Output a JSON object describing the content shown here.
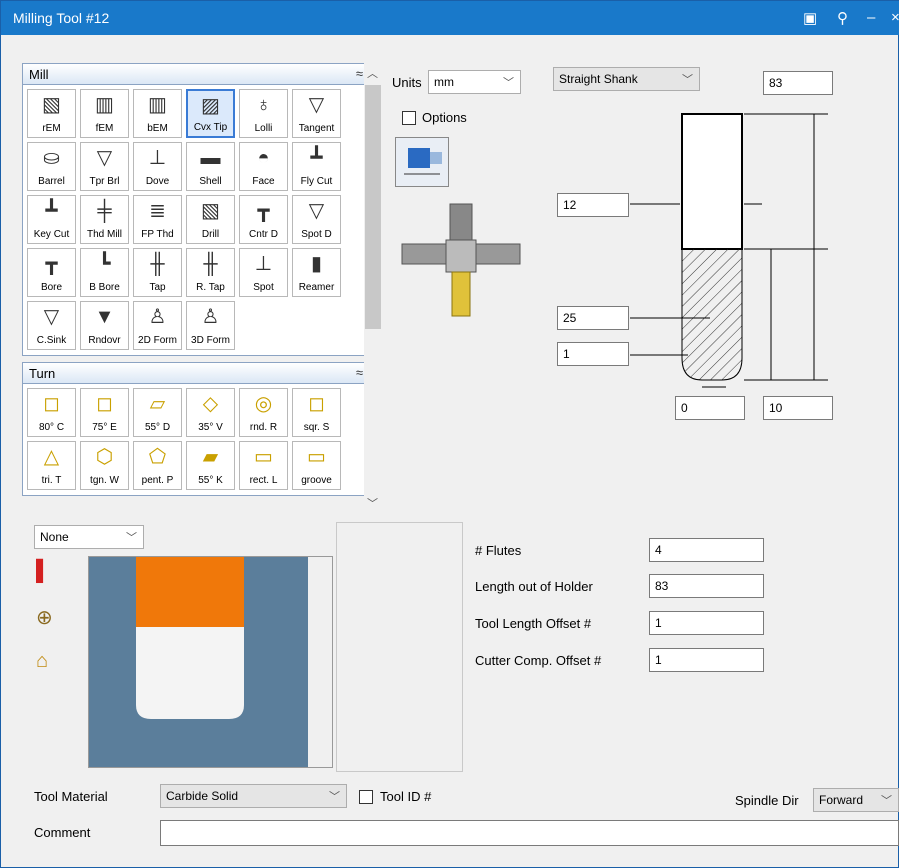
{
  "window": {
    "title": "Milling Tool #12"
  },
  "mill": {
    "header": "Mill",
    "tools": [
      {
        "label": "rEM",
        "icon": "rem-icon",
        "glyph": "▧"
      },
      {
        "label": "fEM",
        "icon": "fem-icon",
        "glyph": "▥"
      },
      {
        "label": "bEM",
        "icon": "bem-icon",
        "glyph": "▥"
      },
      {
        "label": "Cvx Tip",
        "icon": "convex-tip-icon",
        "glyph": "▨",
        "selected": true
      },
      {
        "label": "Lolli",
        "icon": "lollipop-icon",
        "glyph": "♁"
      },
      {
        "label": "Tangent",
        "icon": "tangent-icon",
        "glyph": "▽"
      },
      {
        "label": "Barrel",
        "icon": "barrel-icon",
        "glyph": "⛀"
      },
      {
        "label": "Tpr Brl",
        "icon": "taper-barrel-icon",
        "glyph": "▽"
      },
      {
        "label": "Dove",
        "icon": "dovetail-icon",
        "glyph": "⊥"
      },
      {
        "label": "Shell",
        "icon": "shell-mill-icon",
        "glyph": "▬"
      },
      {
        "label": "Face",
        "icon": "face-mill-icon",
        "glyph": "◓"
      },
      {
        "label": "Fly Cut",
        "icon": "fly-cutter-icon",
        "glyph": "┻"
      },
      {
        "label": "Key Cut",
        "icon": "key-cutter-icon",
        "glyph": "┻"
      },
      {
        "label": "Thd Mill",
        "icon": "thread-mill-icon",
        "glyph": "╪"
      },
      {
        "label": "FP Thd",
        "icon": "fp-thread-icon",
        "glyph": "≣"
      },
      {
        "label": "Drill",
        "icon": "drill-icon",
        "glyph": "▧"
      },
      {
        "label": "Cntr D",
        "icon": "center-drill-icon",
        "glyph": "┳"
      },
      {
        "label": "Spot D",
        "icon": "spot-drill-icon",
        "glyph": "▽"
      },
      {
        "label": "Bore",
        "icon": "bore-icon",
        "glyph": "┳"
      },
      {
        "label": "B Bore",
        "icon": "back-bore-icon",
        "glyph": "┗"
      },
      {
        "label": "Tap",
        "icon": "tap-icon",
        "glyph": "╫"
      },
      {
        "label": "R. Tap",
        "icon": "roll-tap-icon",
        "glyph": "╫"
      },
      {
        "label": "Spot",
        "icon": "spot-icon",
        "glyph": "⊥"
      },
      {
        "label": "Reamer",
        "icon": "reamer-icon",
        "glyph": "▮"
      },
      {
        "label": "C.Sink",
        "icon": "countersink-icon",
        "glyph": "▽"
      },
      {
        "label": "Rndovr",
        "icon": "roundover-icon",
        "glyph": "▼"
      },
      {
        "label": "2D Form",
        "icon": "2d-form-icon",
        "glyph": "♙"
      },
      {
        "label": "3D Form",
        "icon": "3d-form-icon",
        "glyph": "♙"
      }
    ]
  },
  "turn": {
    "header": "Turn",
    "tools": [
      {
        "label": "80° C",
        "icon": "insert-80c-icon",
        "glyph": "◻"
      },
      {
        "label": "75° E",
        "icon": "insert-75e-icon",
        "glyph": "◻"
      },
      {
        "label": "55° D",
        "icon": "insert-55d-icon",
        "glyph": "▱"
      },
      {
        "label": "35° V",
        "icon": "insert-35v-icon",
        "glyph": "◇"
      },
      {
        "label": "rnd. R",
        "icon": "round-insert-icon",
        "glyph": "◎"
      },
      {
        "label": "sqr. S",
        "icon": "square-insert-icon",
        "glyph": "◻"
      },
      {
        "label": "tri. T",
        "icon": "triangle-insert-icon",
        "glyph": "△"
      },
      {
        "label": "tgn. W",
        "icon": "trigon-insert-icon",
        "glyph": "⬡"
      },
      {
        "label": "pent. P",
        "icon": "pentagon-insert-icon",
        "glyph": "⬠"
      },
      {
        "label": "55° K",
        "icon": "insert-55k-icon",
        "glyph": "▰"
      },
      {
        "label": "rect. L",
        "icon": "rect-insert-icon",
        "glyph": "▭"
      },
      {
        "label": "groove",
        "icon": "groove-insert-icon",
        "glyph": "▭"
      }
    ]
  },
  "units": {
    "label": "Units",
    "value": "mm"
  },
  "options": {
    "label": "Options"
  },
  "shank": {
    "value": "Straight Shank"
  },
  "dimensions": {
    "overall_length": "83",
    "diameter": "12",
    "flute_length": "25",
    "corner_radius": "1",
    "tip_offset": "0",
    "shank_length": "10"
  },
  "holder": {
    "value": "None"
  },
  "params": {
    "flutes_label": "# Flutes",
    "flutes": "4",
    "length_label": "Length out of Holder",
    "length": "83",
    "tlo_label": "Tool Length Offset #",
    "tlo": "1",
    "ccomp_label": "Cutter Comp. Offset #",
    "ccomp": "1"
  },
  "material": {
    "label": "Tool Material",
    "value": "Carbide Solid"
  },
  "tool_id": {
    "label": "Tool ID #"
  },
  "spindle": {
    "label": "Spindle Dir",
    "value": "Forward"
  },
  "comment": {
    "label": "Comment",
    "value": ""
  },
  "colors": {
    "title_bar": "#1979ca",
    "selection": "#3a7bd5",
    "shank": "#f0780a",
    "background": "#5b7e9b"
  }
}
